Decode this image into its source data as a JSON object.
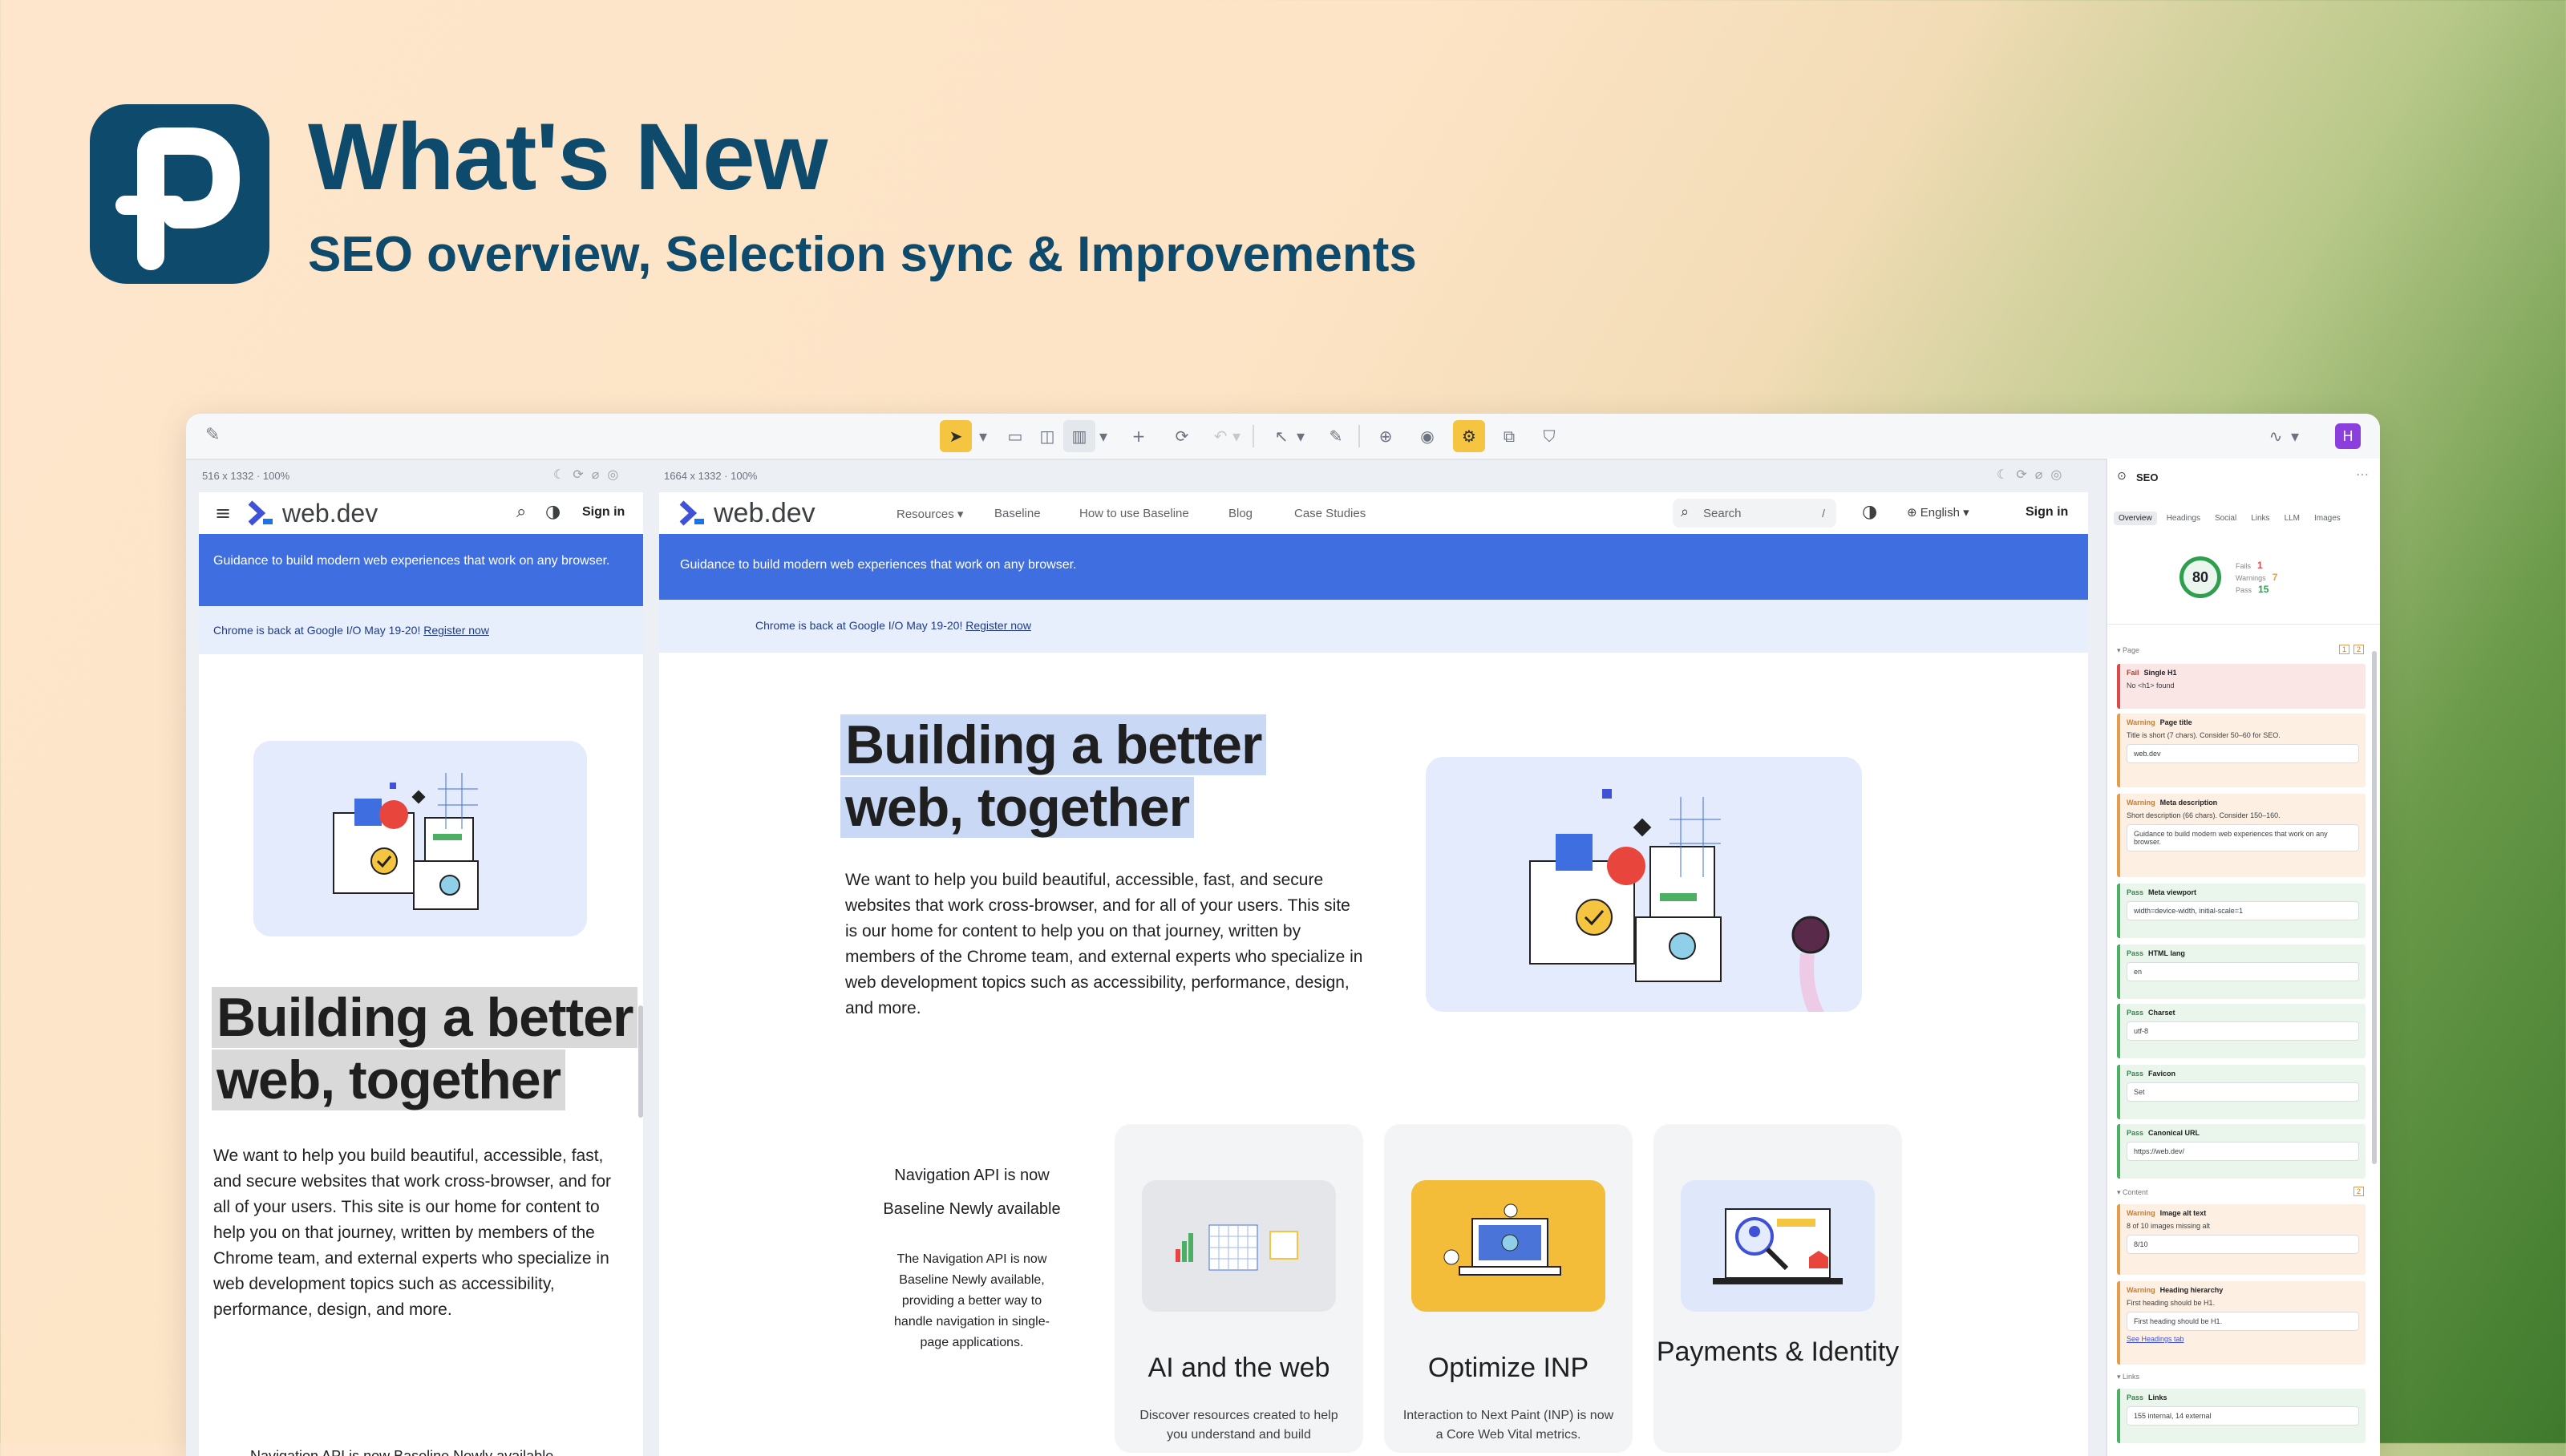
{
  "hero": {
    "title": "What's New",
    "subtitle": "SEO overview, Selection sync & Improvements"
  },
  "toolbar": {
    "icons": [
      "select-tool-icon",
      "view-single-icon",
      "view-split-icon",
      "view-grid-icon",
      "add-icon",
      "refresh-icon",
      "undo-icon",
      "pointer-icon",
      "pen-icon",
      "zoom-icon",
      "eye-icon",
      "seo-plugin-icon",
      "extension-icon",
      "shield-icon",
      "chart-icon"
    ],
    "plugin_badge": "H"
  },
  "mobile_frame": {
    "meta": "516 x 1332 · 100%",
    "logo_text": "web.dev",
    "signin": "Sign in",
    "banner": "Guidance to build modern web experiences that work on any browser.",
    "subbanner_text": "Chrome is back at Google I/O May 19-20!",
    "subbanner_link": "Register now",
    "heading_line1": "Building a better",
    "heading_line2": "web, together",
    "paragraph": "We want to help you build beautiful, accessible, fast, and secure websites that work cross-browser, and for all of your users. This site is our home for content to help you on that journey, written by members of the Chrome team, and external experts who specialize in web development topics such as accessibility, performance, design, and more.",
    "bottom_text": "Navigation API is now Baseline Newly available"
  },
  "desktop_frame": {
    "meta": "1664 x 1332 · 100%",
    "logo_text": "web.dev",
    "nav": [
      "Resources",
      "Baseline",
      "How to use Baseline",
      "Blog",
      "Case Studies"
    ],
    "search_placeholder": "Search",
    "search_shortcut": "/",
    "language": "English",
    "signin": "Sign in",
    "banner": "Guidance to build modern web experiences that work on any browser.",
    "subbanner_text": "Chrome is back at Google I/O May 19-20!",
    "subbanner_link": "Register now",
    "heading_line1": "Building a better",
    "heading_line2": "web, together",
    "paragraph": "We want to help you build beautiful, accessible, fast, and secure websites that work cross-browser, and for all of your users. This site is our home for content to help you on that journey, written by members of the Chrome team, and external experts who specialize in web development topics such as accessibility, performance, design, and more.",
    "news": {
      "title_line1": "Navigation API is now",
      "title_line2": "Baseline Newly available",
      "body": "The Navigation API is now Baseline Newly available, providing a better way to handle navigation in single-page applications."
    },
    "cards": [
      {
        "title": "AI and the web",
        "desc": "Discover resources created to help you understand and build"
      },
      {
        "title": "Optimize INP",
        "desc": "Interaction to Next Paint (INP) is now a Core Web Vital metrics."
      },
      {
        "title": "Payments & Identity",
        "desc": ""
      }
    ]
  },
  "seo_panel": {
    "title": "SEO",
    "tabs": [
      "Overview",
      "Headings",
      "Social",
      "Links",
      "LLM",
      "Images"
    ],
    "score": "80",
    "fails_label": "Fails",
    "fails": "1",
    "warnings_label": "Warnings",
    "warnings": "7",
    "pass_label": "Pass",
    "pass": "15",
    "section_page": "Page",
    "section_content": "Content",
    "section_links": "Links",
    "items": [
      {
        "status": "Fail",
        "name": "Single H1",
        "msg": "No <h1> found",
        "val": ""
      },
      {
        "status": "Warning",
        "name": "Page title",
        "msg": "Title is short (7 chars). Consider 50–60 for SEO.",
        "val": "web.dev"
      },
      {
        "status": "Warning",
        "name": "Meta description",
        "msg": "Short description (66 chars). Consider 150–160.",
        "val": "Guidance to build modern web experiences that work on any browser."
      },
      {
        "status": "Pass",
        "name": "Meta viewport",
        "msg": "",
        "val": "width=device-width, initial-scale=1"
      },
      {
        "status": "Pass",
        "name": "HTML lang",
        "msg": "",
        "val": "en"
      },
      {
        "status": "Pass",
        "name": "Charset",
        "msg": "",
        "val": "utf-8"
      },
      {
        "status": "Pass",
        "name": "Favicon",
        "msg": "",
        "val": "Set"
      },
      {
        "status": "Pass",
        "name": "Canonical URL",
        "msg": "",
        "val": "https://web.dev/"
      }
    ],
    "content_items": [
      {
        "status": "Warning",
        "name": "Image alt text",
        "msg": "8 of 10 images missing alt",
        "val": "8/10"
      },
      {
        "status": "Warning",
        "name": "Heading hierarchy",
        "msg": "First heading should be H1.",
        "val": "First heading should be H1.",
        "link": "See Headings tab"
      }
    ],
    "links_item": {
      "status": "Pass",
      "name": "Links",
      "val": "155 internal, 14 external"
    },
    "page_counts": [
      "1",
      "2"
    ],
    "content_count": "2"
  }
}
